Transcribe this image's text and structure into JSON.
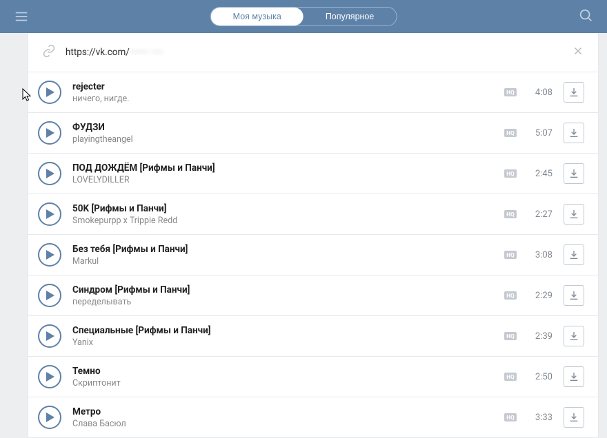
{
  "header": {
    "tab_my_music": "Моя музыка",
    "tab_popular": "Популярное"
  },
  "url_bar": {
    "url_visible": "https://vk.com/",
    "url_hidden": "••••• •••"
  },
  "hq_label": "HQ",
  "tracks": [
    {
      "title": "rejecter",
      "artist": "ничего, нигде.",
      "duration": "4:08"
    },
    {
      "title": "ФУДЗИ",
      "artist": "playingtheangel",
      "duration": "5:07"
    },
    {
      "title": "ПОД ДОЖДЁМ [Рифмы и Панчи]",
      "artist": "LOVELYDILLER",
      "duration": "2:45"
    },
    {
      "title": "50K [Рифмы и Панчи]",
      "artist": "Smokepurpp x Trippie Redd",
      "duration": "2:27"
    },
    {
      "title": "Без тебя [Рифмы и Панчи]",
      "artist": "Markul",
      "duration": "3:08"
    },
    {
      "title": "Синдром [Рифмы и Панчи]",
      "artist": "переделывать",
      "duration": "2:29"
    },
    {
      "title": "Специальные [Рифмы и Панчи]",
      "artist": "Yanix",
      "duration": "2:39"
    },
    {
      "title": "Темно",
      "artist": "Скриптонит",
      "duration": "2:50"
    },
    {
      "title": "Метро",
      "artist": "Слава Басюл",
      "duration": "3:33"
    }
  ]
}
